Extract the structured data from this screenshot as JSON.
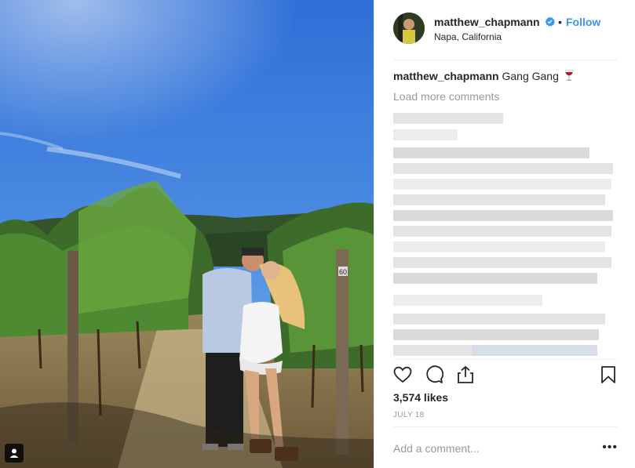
{
  "post": {
    "username": "matthew_chapmann",
    "follow_label": "Follow",
    "separator": "•",
    "location": "Napa, California",
    "verified_icon": "verified-badge-icon",
    "caption_user": "matthew_chapmann",
    "caption_text": "Gang Gang",
    "caption_emoji": "wine-glass-icon",
    "load_more_label": "Load more comments",
    "likes_label": "3,574 likes",
    "date_label": "JULY 18",
    "add_comment_placeholder": "Add a comment...",
    "more_label": "•••"
  },
  "colors": {
    "accent": "#3897f0",
    "text": "#262626",
    "muted": "#999999",
    "divider": "#efefef"
  },
  "icons": {
    "like": "heart-outline-icon",
    "comment": "speech-bubble-icon",
    "share": "share-upload-icon",
    "save": "bookmark-icon",
    "tagged": "person-tag-icon"
  }
}
